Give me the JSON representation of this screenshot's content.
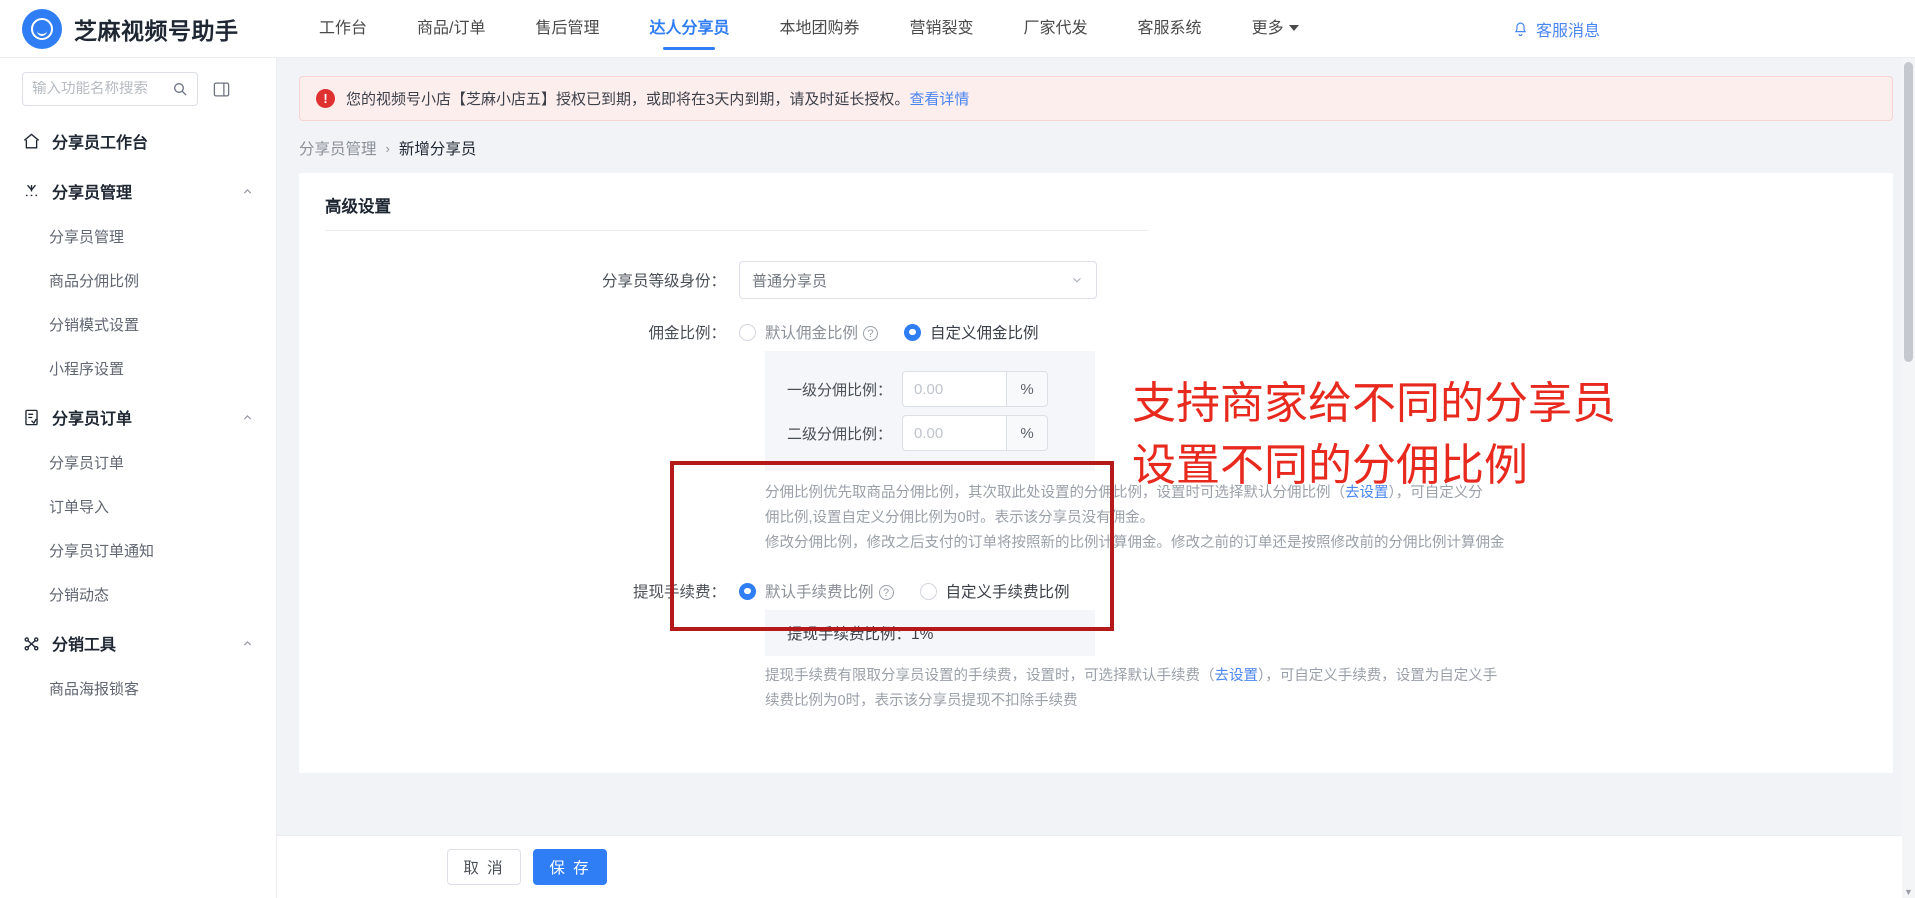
{
  "brand": {
    "name": "芝麻视频号助手",
    "logo_icon": "smile-circle-logo"
  },
  "topnav": {
    "items": [
      {
        "label": "工作台",
        "active": false
      },
      {
        "label": "商品/订单",
        "active": false
      },
      {
        "label": "售后管理",
        "active": false
      },
      {
        "label": "达人分享员",
        "active": true
      },
      {
        "label": "本地团购券",
        "active": false
      },
      {
        "label": "营销裂变",
        "active": false
      },
      {
        "label": "厂家代发",
        "active": false
      },
      {
        "label": "客服系统",
        "active": false
      },
      {
        "label": "更多",
        "active": false,
        "has_caret": true
      }
    ],
    "message_entry": {
      "label": "客服消息",
      "icon": "bell-icon"
    }
  },
  "sidebar": {
    "search": {
      "placeholder": "输入功能名称搜索",
      "value": "",
      "icon": "search-icon"
    },
    "collapse_icon": "panel-collapse-icon",
    "groups": [
      {
        "label": "分享员工作台",
        "icon": "home-icon",
        "expandable": false,
        "items": []
      },
      {
        "label": "分享员管理",
        "icon": "users-icon",
        "expandable": true,
        "chevron": "chevron-up-icon",
        "items": [
          "分享员管理",
          "商品分佣比例",
          "分销模式设置",
          "小程序设置"
        ]
      },
      {
        "label": "分享员订单",
        "icon": "order-doc-icon",
        "expandable": true,
        "chevron": "chevron-up-icon",
        "items": [
          "分享员订单",
          "订单导入",
          "分享员订单通知",
          "分销动态"
        ]
      },
      {
        "label": "分销工具",
        "icon": "share-nodes-icon",
        "expandable": true,
        "chevron": "chevron-up-icon",
        "items": [
          "商品海报锁客"
        ]
      }
    ]
  },
  "alert": {
    "icon": "error-exclamation-icon",
    "text": "您的视频号小店【芝麻小店五】授权已到期，或即将在3天内到期，请及时延长授权。",
    "link": "查看详情"
  },
  "breadcrumb": {
    "parent": "分享员管理",
    "separator": "›",
    "current": "新增分享员"
  },
  "card": {
    "title": "高级设置",
    "level_field": {
      "label": "分享员等级身份：",
      "value": "普通分享员",
      "chevron": "chevron-down-icon"
    },
    "commission": {
      "label": "佣金比例：",
      "options": [
        {
          "label": "默认佣金比例",
          "selected": false,
          "help_icon": "question-circle-icon"
        },
        {
          "label": "自定义佣金比例",
          "selected": true
        }
      ],
      "inputs": [
        {
          "label": "一级分佣比例：",
          "placeholder": "0.00",
          "value": "",
          "suffix": "%"
        },
        {
          "label": "二级分佣比例：",
          "placeholder": "0.00",
          "value": "",
          "suffix": "%"
        }
      ],
      "hint_line1_a": "分佣比例优先取商品分佣比例，其次取此处设置的分佣比例，设置时可选择默认分佣比例（",
      "hint_link1": "去设置",
      "hint_line1_b": "），可自定义分",
      "hint_line2": "佣比例,设置自定义分佣比例为0时。表示该分享员没有佣金。",
      "hint_line3": "修改分佣比例，修改之后支付的订单将按照新的比例计算佣金。修改之前的订单还是按照修改前的分佣比例计算佣金"
    },
    "withdraw_fee": {
      "label": "提现手续费：",
      "options": [
        {
          "label": "默认手续费比例",
          "selected": true,
          "help_icon": "question-circle-icon"
        },
        {
          "label": "自定义手续费比例",
          "selected": false
        }
      ],
      "fee_display": "提现手续费比例：1%",
      "hint_line1_a": "提现手续费有限取分享员设置的手续费，设置时，可选择默认手续费（",
      "hint_link1": "去设置",
      "hint_line1_b": "），可自定义手续费，设置为自定义手",
      "hint_line2": "续费比例为0时，表示该分享员提现不扣除手续费"
    }
  },
  "annotation": {
    "line1": "支持商家给不同的分享员",
    "line2": "设置不同的分佣比例",
    "color": "#e8291e",
    "box_color": "#b51a1a"
  },
  "footer": {
    "cancel_label": "取 消",
    "save_label": "保 存"
  },
  "scrollbar": {
    "up_icon": "chevron-up-icon",
    "down_icon": "chevron-down-icon"
  }
}
